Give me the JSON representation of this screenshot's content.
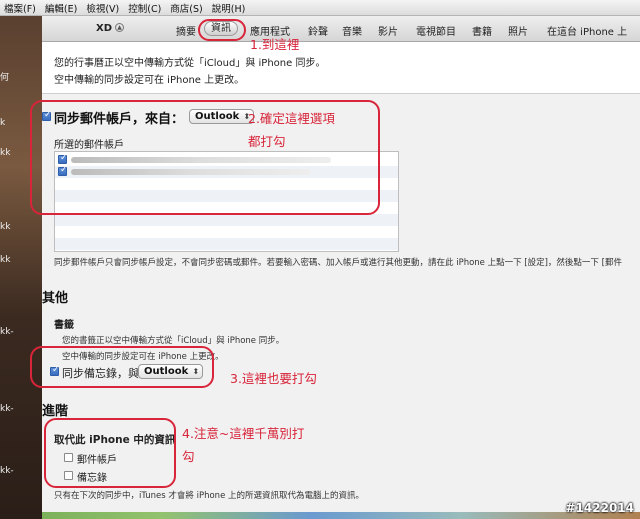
{
  "menu": [
    "檔案(F)",
    "編輯(E)",
    "檢視(V)",
    "控制(C)",
    "商店(S)",
    "說明(H)"
  ],
  "desktop_labels": [
    "何",
    "k",
    "kk",
    "kk",
    "kk",
    "kk-",
    "kk-",
    "kk-"
  ],
  "device": {
    "name": "XD"
  },
  "tabs": [
    "摘要",
    "資訊",
    "應用程式",
    "鈴聲",
    "音樂",
    "影片",
    "電視節目",
    "書籍",
    "照片",
    "在這台 iPhone 上"
  ],
  "intro": {
    "line1": "您的行事曆正以空中傳輸方式從「iCloud」與 iPhone 同步。",
    "line2": "空中傳輸的同步設定可在 iPhone 上更改。"
  },
  "mail": {
    "sync_label": "同步郵件帳戶，來自：",
    "source": "Outlook",
    "accounts_label": "所選的郵件帳戶",
    "footnote": "同步郵件帳戶只會同步帳戶設定，不會同步密碼或郵件。若要輸入密碼、加入帳戶或進行其他更動，請在此 iPhone 上點一下 [設定]，然後點一下 [郵件"
  },
  "other": {
    "heading": "其他",
    "books_label": "書籤",
    "books_line1": "您的書籤正以空中傳輸方式從「iCloud」與 iPhone 同步。",
    "books_line2": "空中傳輸的同步設定可在 iPhone 上更改。",
    "notes_label": "同步備忘錄，與",
    "notes_source": "Outlook"
  },
  "advanced": {
    "heading": "進階",
    "replace_label": "取代此 iPhone 中的資訊",
    "mail_accounts": "郵件帳戶",
    "notes": "備忘錄",
    "footnote": "只有在下次的同步中，iTunes 才會將 iPhone 上的所選資訊取代為電腦上的資訊。"
  },
  "annotations": {
    "a1": "1.到這裡",
    "a2_line1": "2.確定這裡選項",
    "a2_line2": "都打勾",
    "a3": "3.這裡也要打勾",
    "a4_line1": "4.注意~這裡千萬別打",
    "a4_line2": "勾"
  },
  "watermark": "#1422014",
  "colors": {
    "annotation": "#d8253a",
    "checkbox": "#3a6dbf"
  }
}
